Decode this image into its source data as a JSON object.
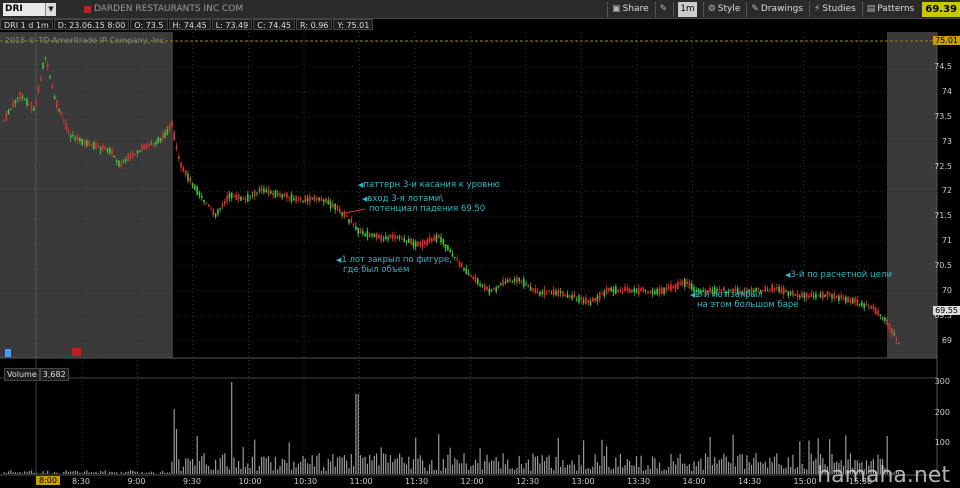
{
  "toolbar": {
    "symbol": "DRI",
    "company": "DARDEN RESTAURANTS INC COM",
    "share_label": "Share",
    "interval_label": "1m",
    "style_label": "Style",
    "drawings_label": "Drawings",
    "studies_label": "Studies",
    "patterns_label": "Patterns",
    "last_price": "69.39"
  },
  "infobar": {
    "chart_id": "DRI 1 d 1m",
    "date": "D: 23.06.15 8:00",
    "open": "O: 73.5",
    "high": "H: 74.45",
    "low": "L: 73.49",
    "close": "C: 74.45",
    "range": "R: 0.96",
    "y": "Y: 75.01"
  },
  "copyright": "2015 © TD Ameritrade IP Company, Inc.",
  "price_axis": {
    "labels": [
      "75",
      "74.5",
      "74",
      "73.5",
      "73",
      "72.5",
      "72",
      "71.5",
      "71",
      "70.5",
      "70",
      "69.5",
      "69"
    ],
    "tag_top": "75.01",
    "tag_last": "69.55"
  },
  "annotations": {
    "a1": "паттерн 3-и касания к уровню",
    "a2_line1": "вход 3-я лотами\\",
    "a2_line2": "потенциал падения 69.50",
    "a3_line1": "1 лот закрыл по фигуре,",
    "a3_line2": "где был объем",
    "a4_line1": "2-й лот закрыл",
    "a4_line2": "на этом большом баре",
    "a5": "3-й по расчетной цели"
  },
  "volume": {
    "label": "Volume",
    "value": "3,682",
    "axis_labels": [
      "300",
      "200",
      "100"
    ]
  },
  "time_axis": {
    "highlight": "8:00",
    "labels": [
      "8:30",
      "9:00",
      "9:30",
      "10:00",
      "10:30",
      "11:00",
      "11:30",
      "12:00",
      "12:30",
      "13:00",
      "13:30",
      "14:00",
      "14:30",
      "15:00",
      "15:30"
    ]
  },
  "watermark": "hamaha.net",
  "colors": {
    "up": "#3cc83c",
    "down": "#e03030",
    "annotation": "#2fb8c8",
    "extended_hours": "#3a3a3a",
    "price_tag": "#c8c800"
  }
}
